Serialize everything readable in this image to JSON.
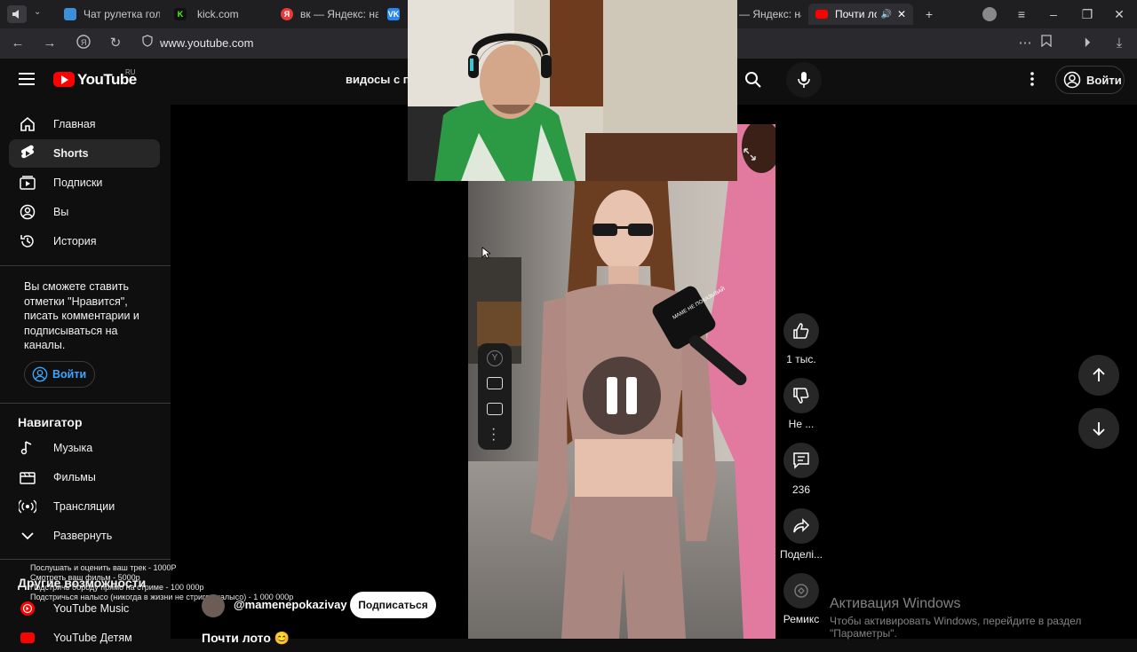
{
  "browser": {
    "tabs": [
      {
        "label": "Чат рулетка гол",
        "favicon": "#3d8fd6"
      },
      {
        "label": "kick.com",
        "favicon": "#53fc18"
      },
      {
        "label": "вк — Яндекс: на",
        "favicon": "#e83a3a"
      },
      {
        "label": "В",
        "favicon": "#2787f5"
      },
      {
        "label": "— Яндекс: на",
        "favicon": ""
      },
      {
        "label": "Почти лото",
        "favicon": "#ff0000"
      }
    ],
    "url": "www.youtube.com"
  },
  "header": {
    "logo_text": "YouTube",
    "logo_region": "RU",
    "search_text": "видосы с п",
    "login_label": "Войти"
  },
  "sidebar": {
    "items": [
      {
        "label": "Главная",
        "icon": "home-icon"
      },
      {
        "label": "Shorts",
        "icon": "shorts-icon"
      },
      {
        "label": "Подписки",
        "icon": "subscriptions-icon"
      },
      {
        "label": "Вы",
        "icon": "you-icon"
      },
      {
        "label": "История",
        "icon": "history-icon"
      }
    ],
    "signin_prompt": [
      "Вы сможете ставить",
      "отметки \"Нравится\",",
      "писать комментарии и",
      "подписываться на",
      "каналы."
    ],
    "signin_label": "Войти",
    "navigator_title": "Навигатор",
    "navigator_items": [
      {
        "label": "Музыка",
        "icon": "music-icon"
      },
      {
        "label": "Фильмы",
        "icon": "movies-icon"
      },
      {
        "label": "Трансляции",
        "icon": "live-icon"
      },
      {
        "label": "Развернуть",
        "icon": "chevron-down-icon"
      }
    ],
    "more_title": "Другие возможности",
    "more_items": [
      {
        "label": "YouTube Music",
        "icon": "youtube-music-icon"
      },
      {
        "label": "YouTube Детям",
        "icon": "youtube-kids-icon"
      }
    ]
  },
  "overlay_text": [
    "Послушать и оценить ваш трек - 1000Р",
    "Смотреть ваш фильм - 5000р",
    "Подстричь бороду прямо на стриме - 100 000р",
    "Подстричься налысо (никогда в жизни не стригся налысо) - 1 000 000р"
  ],
  "short": {
    "channel": "@mamenepokazivay",
    "subscribe_label": "Подписаться",
    "title_partial": "Почти лото 😊",
    "mic_text": "МАМЕ НЕ ПОКАЗЫВАЙ",
    "likes": "1 тыс.",
    "dislike_label": "Не ...",
    "comments": "236",
    "share_label": "Поделі...",
    "remix_label": "Ремикс"
  },
  "windows_watermark": {
    "title": "Активация Windows",
    "line1": "Чтобы активировать Windows, перейдите в раздел",
    "line2": "\"Параметры\"."
  },
  "colors": {
    "accent": "#3ea6ff",
    "brand": "#ff0000"
  }
}
